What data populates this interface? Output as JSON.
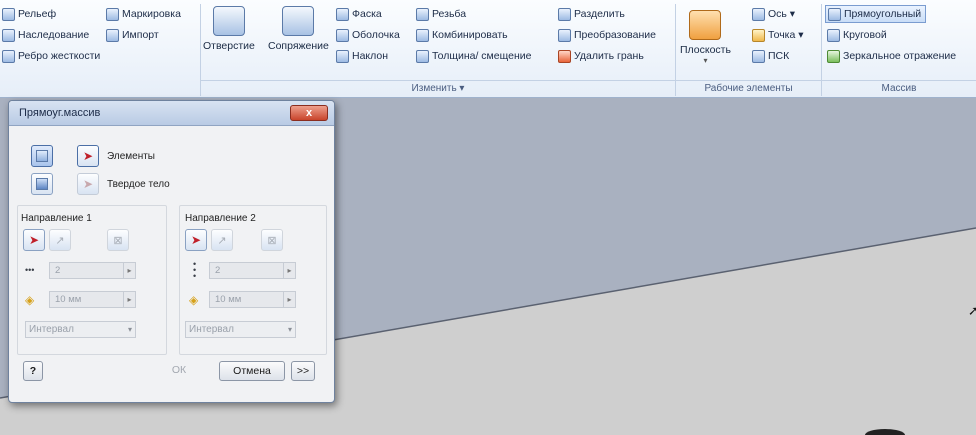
{
  "ribbon": {
    "create_panel": {
      "items": [
        "Рельеф",
        "Наследование",
        "Ребро жесткости"
      ],
      "right_items": [
        "Маркировка",
        "Импорт"
      ]
    },
    "modify_panel": {
      "big_buttons": [
        "Отверстие",
        "Сопряжение"
      ],
      "col1": [
        "Фаска",
        "Оболочка",
        "Наклон"
      ],
      "col2": [
        "Резьба",
        "Комбинировать",
        "Толщина/ смещение"
      ],
      "col3": [
        "Разделить",
        "Преобразование",
        "Удалить грань"
      ],
      "group_label": "Изменить ▾"
    },
    "work_panel": {
      "plane": "Плоскость",
      "items": [
        "Ось ▾",
        "Точка ▾",
        "ПСК"
      ],
      "group_label": "Рабочие элементы"
    },
    "pattern_panel": {
      "items": [
        "Прямоугольный",
        "Круговой",
        "Зеркальное отражение"
      ],
      "group_label": "Массив"
    }
  },
  "dialog": {
    "title": "Прямоуг.массив",
    "close_label": "x",
    "elements_label": "Элементы",
    "solid_label": "Твердое тело",
    "direction1": {
      "label": "Направление 1",
      "count": "2",
      "spacing": "10 мм",
      "mode": "Интервал"
    },
    "direction2": {
      "label": "Направление 2",
      "count": "2",
      "spacing": "10 мм",
      "mode": "Интервал"
    },
    "help_label": "?",
    "ok_label": "ОК",
    "cancel_label": "Отмена",
    "more_label": ">>"
  },
  "icons": {
    "cursor": "arrow-cursor",
    "elements": "select-arrow-icon",
    "solid": "solid-body-icon"
  },
  "colors": {
    "ribbon_bg": "#e6eef8",
    "dialog_close": "#c8442b",
    "select_arrow": "#c0202a"
  }
}
